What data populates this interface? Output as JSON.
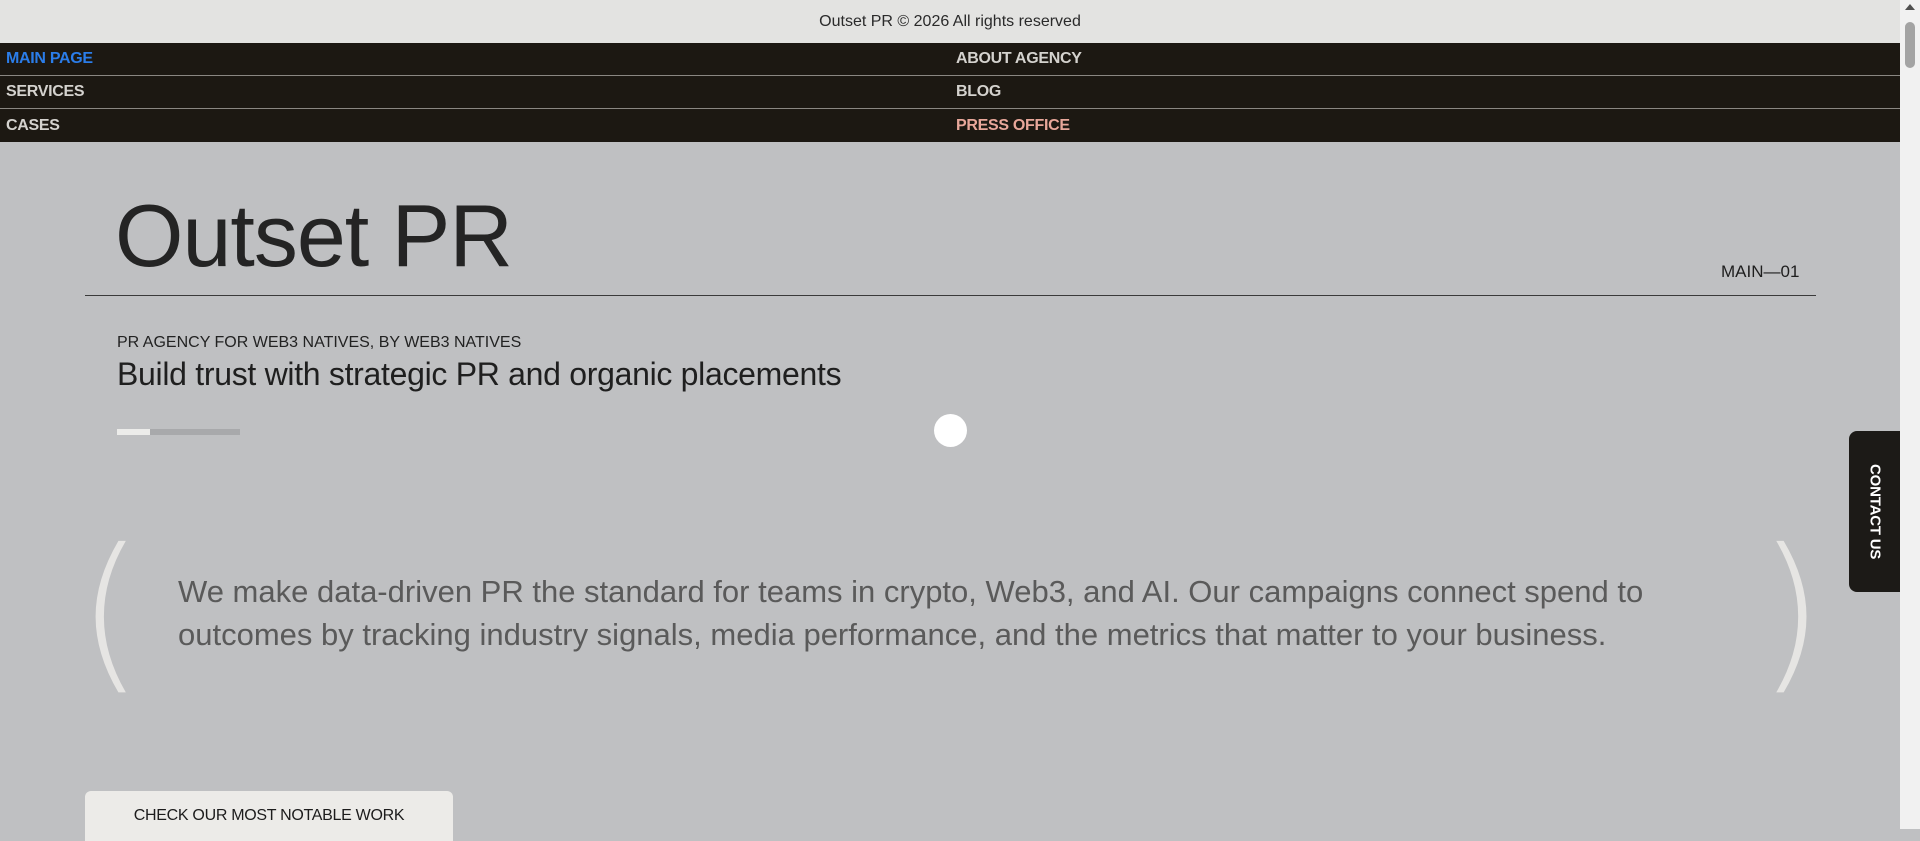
{
  "footer_top": {
    "text": "Outset PR © 2026 All rights reserved"
  },
  "nav": {
    "items": [
      {
        "label": "MAIN PAGE",
        "state": "active"
      },
      {
        "label": "ABOUT AGENCY"
      },
      {
        "label": "SERVICES"
      },
      {
        "label": "BLOG"
      },
      {
        "label": "CASES"
      },
      {
        "label": "PRESS OFFICE",
        "state": "accent"
      }
    ]
  },
  "hero": {
    "title": "Outset PR",
    "section_label": "MAIN—01",
    "eyebrow": "PR AGENCY FOR WEB3 NATIVES, BY WEB3 NATIVES",
    "subtitle": "Build trust with strategic PR and organic placements",
    "slide_progress": 0.27
  },
  "quote": {
    "open": "(",
    "close": ")",
    "text": "We make data-driven PR the standard for teams in crypto, Web3, and AI. Our campaigns connect spend to outcomes by tracking industry signals, media performance, and the metrics that matter to your business."
  },
  "contact": {
    "label": "CONTACT US"
  },
  "cta": {
    "label": "CHECK OUR MOST NOTABLE WORK"
  },
  "colors": {
    "page_bg": "#bfc0c2",
    "nav_bg": "#1c1812",
    "nav_active": "#2b7de9",
    "nav_accent": "#e8a79a",
    "topbar_bg": "#e3e3e1"
  }
}
